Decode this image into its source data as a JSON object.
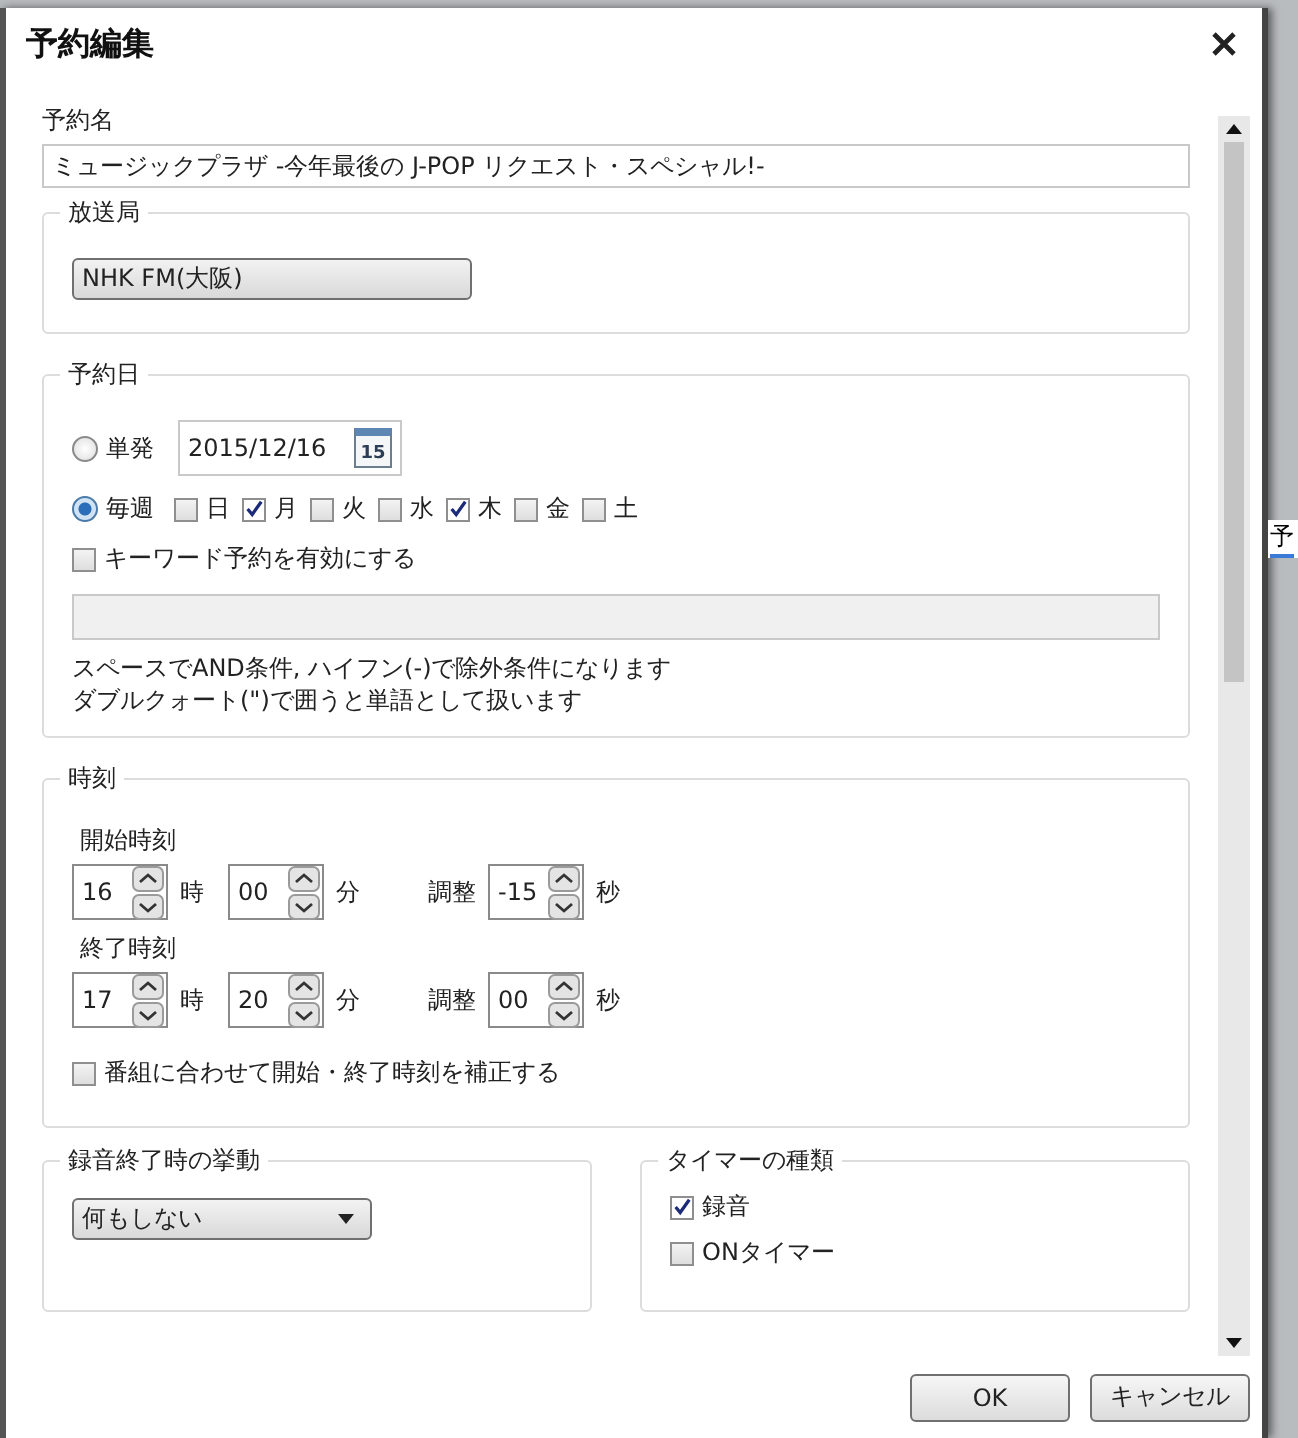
{
  "background": {
    "tab_label": "予"
  },
  "dialog": {
    "title": "予約編集"
  },
  "program_name": {
    "label": "予約名",
    "value": "ミュージックプラザ -今年最後の J-POP リクエスト・スペシャル!-"
  },
  "station": {
    "legend": "放送局",
    "value": "NHK FM(大阪)"
  },
  "schedule": {
    "legend": "予約日",
    "date": "2015/12/16",
    "calendar_day": "15",
    "modes": [
      {
        "label": "単発",
        "selected": false
      },
      {
        "label": "毎週",
        "selected": true
      }
    ],
    "weekdays": [
      {
        "label": "日",
        "checked": false
      },
      {
        "label": "月",
        "checked": true
      },
      {
        "label": "火",
        "checked": false
      },
      {
        "label": "水",
        "checked": false
      },
      {
        "label": "木",
        "checked": true
      },
      {
        "label": "金",
        "checked": false
      },
      {
        "label": "土",
        "checked": false
      }
    ],
    "keyword": {
      "label": "キーワード予約を有効にする",
      "checked": false
    },
    "hints": [
      "スペースでAND条件, ハイフン(-)で除外条件になります",
      "ダブルクォート(\")で囲うと単語として扱います"
    ]
  },
  "time": {
    "legend": "時刻",
    "rows": [
      {
        "label": "開始時刻",
        "hour": "16",
        "hour_unit": "時",
        "minute": "00",
        "minute_unit": "分",
        "adjust_label": "調整",
        "adjust": "-15",
        "adjust_unit": "秒"
      },
      {
        "label": "終了時刻",
        "hour": "17",
        "hour_unit": "時",
        "minute": "20",
        "minute_unit": "分",
        "adjust_label": "調整",
        "adjust": "00",
        "adjust_unit": "秒"
      }
    ],
    "auto_adjust": {
      "label": "番組に合わせて開始・終了時刻を補正する",
      "checked": false
    }
  },
  "end_action": {
    "legend": "録音終了時の挙動",
    "value": "何もしない"
  },
  "timer_types": {
    "legend": "タイマーの種類",
    "items": [
      {
        "label": "録音",
        "checked": true
      },
      {
        "label": "ONタイマー",
        "checked": false
      }
    ]
  },
  "buttons": [
    {
      "label": "OK"
    },
    {
      "label": "キャンセル"
    }
  ]
}
